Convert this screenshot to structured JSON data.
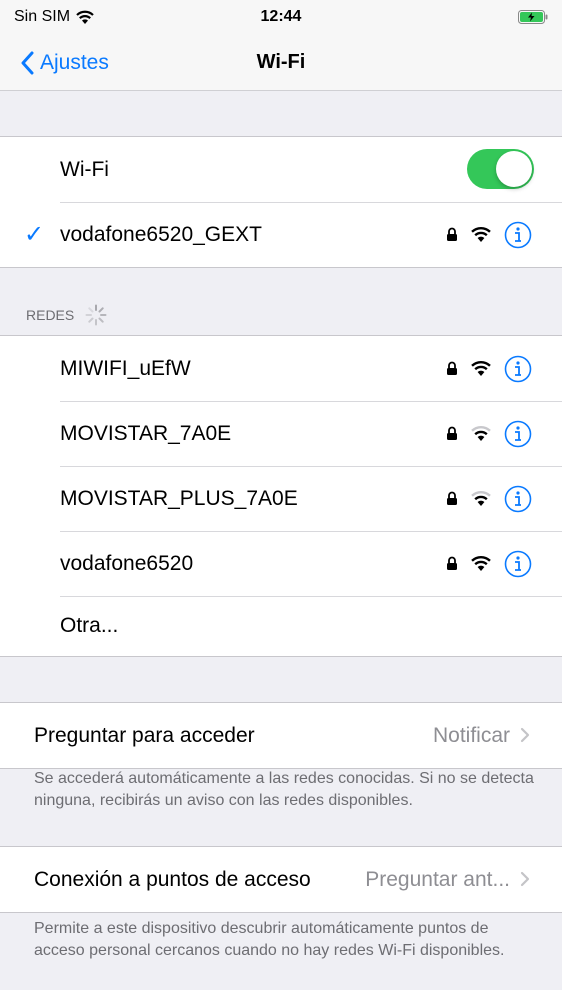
{
  "status_bar": {
    "carrier": "Sin SIM",
    "time": "12:44"
  },
  "nav": {
    "back_label": "Ajustes",
    "title": "Wi-Fi"
  },
  "wifi": {
    "label": "Wi-Fi",
    "enabled": true,
    "connected_network": "vodafone6520_GEXT"
  },
  "networks_header": "REDES",
  "networks": [
    {
      "name": "MIWIFI_uEfW",
      "secured": true,
      "signal": "full"
    },
    {
      "name": "MOVISTAR_7A0E",
      "secured": true,
      "signal": "medium"
    },
    {
      "name": "MOVISTAR_PLUS_7A0E",
      "secured": true,
      "signal": "medium"
    },
    {
      "name": "vodafone6520",
      "secured": true,
      "signal": "full"
    }
  ],
  "other_label": "Otra...",
  "ask_to_join": {
    "label": "Preguntar para acceder",
    "value": "Notificar",
    "footer": "Se accederá automáticamente a las redes conocidas. Si no se detecta ninguna, recibirás un aviso con las redes disponibles."
  },
  "hotspot": {
    "label": "Conexión a puntos de acceso",
    "value": "Preguntar ant...",
    "footer": "Permite a este dispositivo descubrir automáticamente puntos de acceso personal cercanos cuando no hay redes Wi-Fi disponibles."
  },
  "colors": {
    "accent": "#0a7aff",
    "toggle_on": "#34c759",
    "background": "#efeff4"
  }
}
